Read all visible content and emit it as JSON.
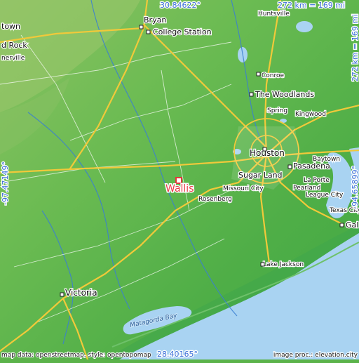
{
  "map": {
    "focus": {
      "name": "Wallis",
      "marker_color": "#e03a3a"
    },
    "coordinates": {
      "north": "30.84622°",
      "south": "28.40165°",
      "west": "-97.47149°",
      "east": "-94.65899°"
    },
    "scale": {
      "horizontal": "272 km = 169 mi",
      "vertical": "272 km = 169 mi"
    },
    "places": {
      "bryan": "Bryan",
      "college_station": "College Station",
      "huntsville": "Huntsville",
      "round_rock": "d Rock",
      "georgetown": "town",
      "pflugerville": "nerville",
      "conroe": "Conroe",
      "the_woodlands": "The Woodlands",
      "spring": "Spring",
      "kingwood": "Kingwood",
      "houston": "Houston",
      "baytown": "Baytown",
      "pasadena": "Pasadena",
      "sugar_land": "Sugar Land",
      "la_porte": "La Porte",
      "missouri_city": "Missouri City",
      "pearland": "Pearland",
      "league_city": "League City",
      "rosenberg": "Rosenberg",
      "texas_city": "Texas City",
      "galveston": "Gal",
      "lake_jackson": "Lake Jackson",
      "victoria": "Victoria",
      "matagorda_bay": "Matagorda Bay"
    },
    "credits": {
      "left": "map data: openstreetmap, style: opentopomap",
      "right": "image proc.: elevation.city"
    },
    "colors": {
      "land": "#5bb34a",
      "highland": "#93c66a",
      "sea": "#a9d3f2",
      "road": "#f1c93a",
      "label_blue": "#3b6fd8"
    }
  }
}
